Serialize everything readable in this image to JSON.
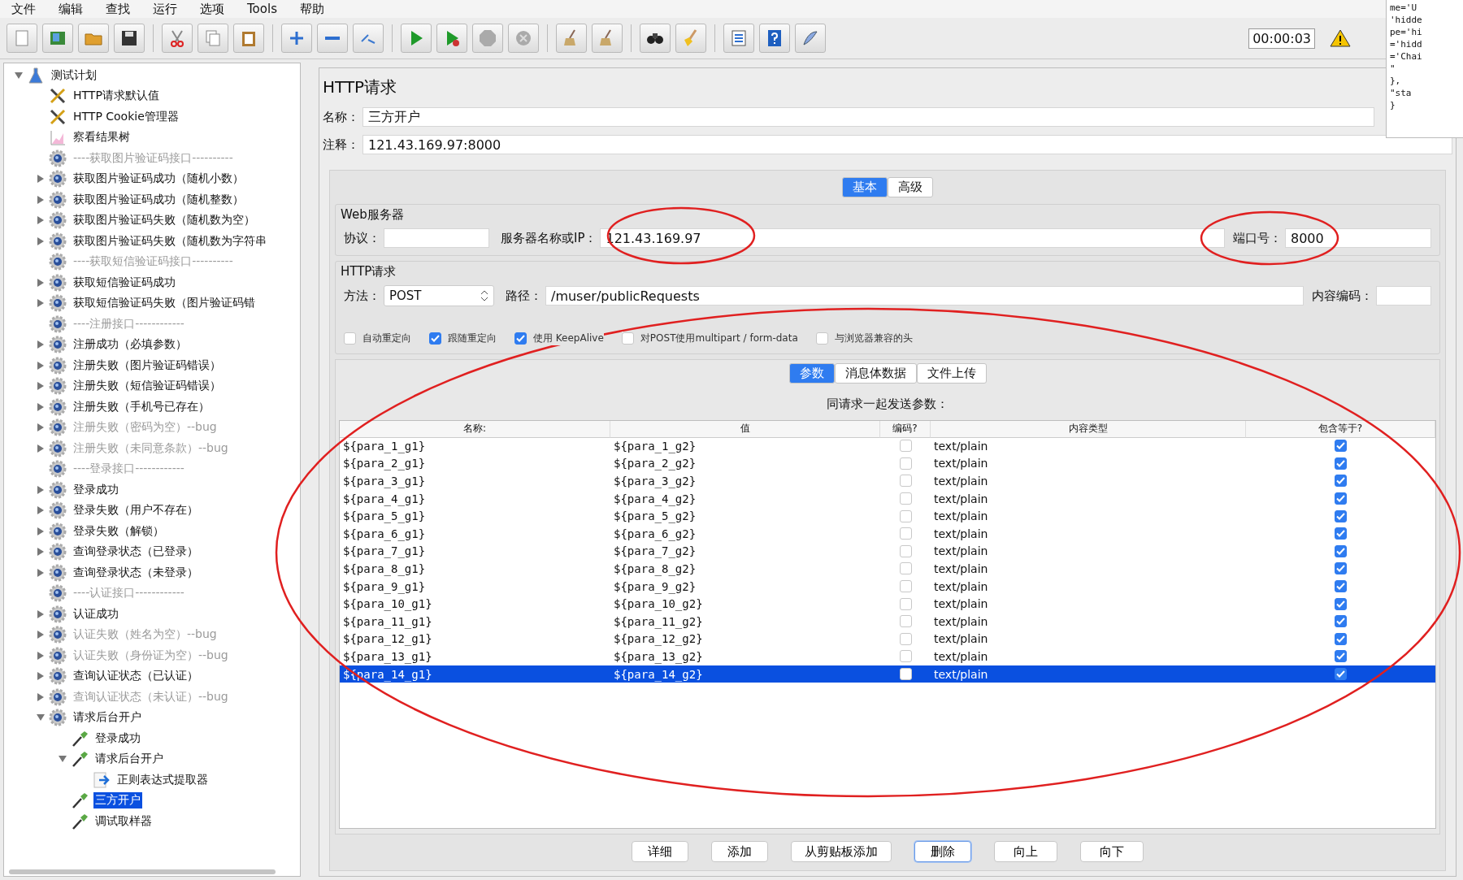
{
  "menu": [
    "文件",
    "编辑",
    "查找",
    "运行",
    "选项",
    "Tools",
    "帮助"
  ],
  "toolbar": {
    "timer": "00:00:03"
  },
  "code_window": {
    "lines": [
      "me='U",
      "'hidde",
      "pe='hi",
      "='hidd",
      "='Chai",
      "\"",
      "},",
      "\"sta",
      "}"
    ]
  },
  "tree": [
    {
      "label": "测试计划",
      "kind": "plan",
      "expanded": true,
      "selected": false,
      "disabled": false,
      "children": [
        {
          "label": "HTTP请求默认值",
          "kind": "config",
          "selected": false,
          "disabled": false
        },
        {
          "label": "HTTP Cookie管理器",
          "kind": "config",
          "selected": false,
          "disabled": false
        },
        {
          "label": "察看结果树",
          "kind": "listener",
          "selected": false,
          "disabled": false
        },
        {
          "label": "----获取图片验证码接口----------",
          "kind": "thread",
          "selected": false,
          "disabled": true
        },
        {
          "label": "获取图片验证码成功（随机小数）",
          "kind": "thread",
          "expanded": false,
          "selected": false,
          "disabled": false
        },
        {
          "label": "获取图片验证码成功（随机整数）",
          "kind": "thread",
          "expanded": false,
          "selected": false,
          "disabled": false
        },
        {
          "label": "获取图片验证码失败（随机数为空）",
          "kind": "thread",
          "expanded": false,
          "selected": false,
          "disabled": false
        },
        {
          "label": "获取图片验证码失败（随机数为字符串",
          "kind": "thread",
          "expanded": false,
          "selected": false,
          "disabled": false
        },
        {
          "label": "----获取短信验证码接口----------",
          "kind": "thread",
          "selected": false,
          "disabled": true
        },
        {
          "label": "获取短信验证码成功",
          "kind": "thread",
          "expanded": false,
          "selected": false,
          "disabled": false
        },
        {
          "label": "获取短信验证码失败（图片验证码错",
          "kind": "thread",
          "expanded": false,
          "selected": false,
          "disabled": false
        },
        {
          "label": "----注册接口------------",
          "kind": "thread",
          "selected": false,
          "disabled": true
        },
        {
          "label": "注册成功（必填参数）",
          "kind": "thread",
          "expanded": false,
          "selected": false,
          "disabled": false
        },
        {
          "label": "注册失败（图片验证码错误）",
          "kind": "thread",
          "expanded": false,
          "selected": false,
          "disabled": false
        },
        {
          "label": "注册失败（短信验证码错误）",
          "kind": "thread",
          "expanded": false,
          "selected": false,
          "disabled": false
        },
        {
          "label": "注册失败（手机号已存在）",
          "kind": "thread",
          "expanded": false,
          "selected": false,
          "disabled": false
        },
        {
          "label": "注册失败（密码为空）--bug",
          "kind": "thread",
          "expanded": false,
          "selected": false,
          "disabled": true
        },
        {
          "label": "注册失败（未同意条款）--bug",
          "kind": "thread",
          "expanded": false,
          "selected": false,
          "disabled": true
        },
        {
          "label": "----登录接口------------",
          "kind": "thread",
          "selected": false,
          "disabled": true
        },
        {
          "label": "登录成功",
          "kind": "thread",
          "expanded": false,
          "selected": false,
          "disabled": false
        },
        {
          "label": "登录失败（用户不存在）",
          "kind": "thread",
          "expanded": false,
          "selected": false,
          "disabled": false
        },
        {
          "label": "登录失败（解锁）",
          "kind": "thread",
          "expanded": false,
          "selected": false,
          "disabled": false
        },
        {
          "label": "查询登录状态（已登录）",
          "kind": "thread",
          "expanded": false,
          "selected": false,
          "disabled": false
        },
        {
          "label": "查询登录状态（未登录）",
          "kind": "thread",
          "expanded": false,
          "selected": false,
          "disabled": false
        },
        {
          "label": "----认证接口------------",
          "kind": "thread",
          "selected": false,
          "disabled": true
        },
        {
          "label": "认证成功",
          "kind": "thread",
          "expanded": false,
          "selected": false,
          "disabled": false
        },
        {
          "label": "认证失败（姓名为空）--bug",
          "kind": "thread",
          "expanded": false,
          "selected": false,
          "disabled": true
        },
        {
          "label": "认证失败（身份证为空）--bug",
          "kind": "thread",
          "expanded": false,
          "selected": false,
          "disabled": true
        },
        {
          "label": "查询认证状态（已认证）",
          "kind": "thread",
          "expanded": false,
          "selected": false,
          "disabled": false
        },
        {
          "label": "查询认证状态（未认证）--bug",
          "kind": "thread",
          "expanded": false,
          "selected": false,
          "disabled": true
        },
        {
          "label": "请求后台开户",
          "kind": "thread",
          "expanded": true,
          "selected": false,
          "disabled": false,
          "children": [
            {
              "label": "登录成功",
              "kind": "sampler",
              "selected": false,
              "disabled": false
            },
            {
              "label": "请求后台开户",
              "kind": "sampler",
              "expanded": true,
              "selected": false,
              "disabled": false,
              "children": [
                {
                  "label": "正则表达式提取器",
                  "kind": "extractor",
                  "selected": false,
                  "disabled": false
                }
              ]
            },
            {
              "label": "三方开户",
              "kind": "sampler",
              "selected": true,
              "disabled": false
            },
            {
              "label": "调试取样器",
              "kind": "sampler",
              "selected": false,
              "disabled": false
            }
          ]
        }
      ]
    }
  ],
  "editor": {
    "title": "HTTP请求",
    "name_label": "名称：",
    "name": "三方开户",
    "comment_label": "注释：",
    "comment": "121.43.169.97:8000",
    "tabs": [
      {
        "label": "基本",
        "selected": true
      },
      {
        "label": "高级",
        "selected": false
      }
    ],
    "web_server": {
      "legend": "Web服务器",
      "protocol_label": "协议：",
      "server_label": "服务器名称或IP：",
      "server": "121.43.169.97",
      "port_label": "端口号：",
      "port": "8000"
    },
    "http_request": {
      "legend": "HTTP请求",
      "method_label": "方法：",
      "method": "POST",
      "path_label": "路径：",
      "path": "/muser/publicRequests",
      "encoding_label": "内容编码：",
      "options": [
        {
          "label": "自动重定向",
          "checked": false
        },
        {
          "label": "跟随重定向",
          "checked": true
        },
        {
          "label": "使用 KeepAlive",
          "checked": true
        },
        {
          "label": "对POST使用multipart / form-data",
          "checked": false
        },
        {
          "label": "与浏览器兼容的头",
          "checked": false
        }
      ]
    },
    "param_tabs": [
      {
        "label": "参数",
        "selected": true
      },
      {
        "label": "消息体数据",
        "selected": false
      },
      {
        "label": "文件上传",
        "selected": false
      }
    ],
    "params": {
      "caption": "同请求一起发送参数：",
      "columns": [
        "名称:",
        "值",
        "编码?",
        "内容类型",
        "包含等于?"
      ],
      "rows": [
        {
          "name": "${para_1_g1}",
          "value": "${para_1_g2}",
          "encode": false,
          "content_type": "text/plain",
          "include_equals": true,
          "selected": false
        },
        {
          "name": "${para_2_g1}",
          "value": "${para_2_g2}",
          "encode": false,
          "content_type": "text/plain",
          "include_equals": true,
          "selected": false
        },
        {
          "name": "${para_3_g1}",
          "value": "${para_3_g2}",
          "encode": false,
          "content_type": "text/plain",
          "include_equals": true,
          "selected": false
        },
        {
          "name": "${para_4_g1}",
          "value": "${para_4_g2}",
          "encode": false,
          "content_type": "text/plain",
          "include_equals": true,
          "selected": false
        },
        {
          "name": "${para_5_g1}",
          "value": "${para_5_g2}",
          "encode": false,
          "content_type": "text/plain",
          "include_equals": true,
          "selected": false
        },
        {
          "name": "${para_6_g1}",
          "value": "${para_6_g2}",
          "encode": false,
          "content_type": "text/plain",
          "include_equals": true,
          "selected": false
        },
        {
          "name": "${para_7_g1}",
          "value": "${para_7_g2}",
          "encode": false,
          "content_type": "text/plain",
          "include_equals": true,
          "selected": false
        },
        {
          "name": "${para_8_g1}",
          "value": "${para_8_g2}",
          "encode": false,
          "content_type": "text/plain",
          "include_equals": true,
          "selected": false
        },
        {
          "name": "${para_9_g1}",
          "value": "${para_9_g2}",
          "encode": false,
          "content_type": "text/plain",
          "include_equals": true,
          "selected": false
        },
        {
          "name": "${para_10_g1}",
          "value": "${para_10_g2}",
          "encode": false,
          "content_type": "text/plain",
          "include_equals": true,
          "selected": false
        },
        {
          "name": "${para_11_g1}",
          "value": "${para_11_g2}",
          "encode": false,
          "content_type": "text/plain",
          "include_equals": true,
          "selected": false
        },
        {
          "name": "${para_12_g1}",
          "value": "${para_12_g2}",
          "encode": false,
          "content_type": "text/plain",
          "include_equals": true,
          "selected": false
        },
        {
          "name": "${para_13_g1}",
          "value": "${para_13_g2}",
          "encode": false,
          "content_type": "text/plain",
          "include_equals": true,
          "selected": false
        },
        {
          "name": "${para_14_g1}",
          "value": "${para_14_g2}",
          "encode": false,
          "content_type": "text/plain",
          "include_equals": true,
          "selected": true
        }
      ]
    },
    "buttons": [
      {
        "label": "详细",
        "focused": false
      },
      {
        "label": "添加",
        "focused": false
      },
      {
        "label": "从剪贴板添加",
        "focused": false
      },
      {
        "label": "删除",
        "focused": true
      },
      {
        "label": "向上",
        "focused": false
      },
      {
        "label": "向下",
        "focused": false
      }
    ]
  }
}
